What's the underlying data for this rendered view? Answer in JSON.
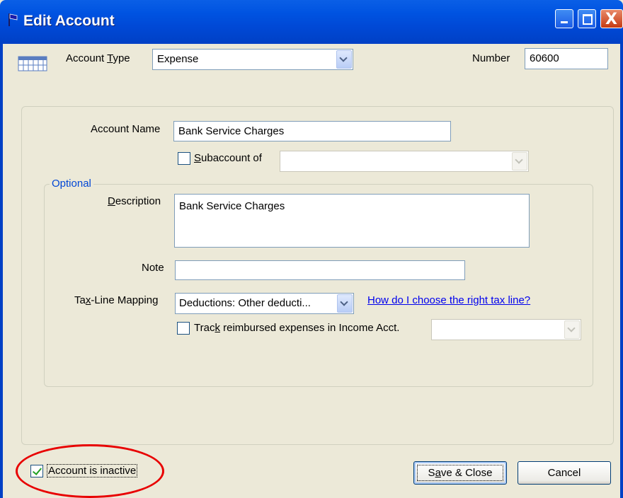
{
  "window": {
    "title": "Edit Account",
    "close_glyph": "X"
  },
  "header": {
    "account_type_label_pre": "Account ",
    "account_type_label_u": "T",
    "account_type_label_post": "ype",
    "account_type_value": "Expense",
    "number_label": "Number",
    "number_value": "60600"
  },
  "form": {
    "account_name_label": "Account Name",
    "account_name_value": "Bank Service Charges",
    "subaccount_label_u": "S",
    "subaccount_label_post": "ubaccount of",
    "subaccount_value": "",
    "subaccount_checked": false
  },
  "optional": {
    "legend": "Optional",
    "description_label_u": "D",
    "description_label_post": "escription",
    "description_value": "Bank Service Charges",
    "note_label": "Note",
    "note_value": "",
    "tax_label_pre": "Ta",
    "tax_label_u": "x",
    "tax_label_post": "-Line Mapping",
    "tax_value": "Deductions: Other deducti...",
    "tax_help_link": "How do I choose the right tax line?",
    "track_label_pre": "Trac",
    "track_label_u": "k",
    "track_label_post": " reimbursed expenses in Income Acct.",
    "track_checked": false,
    "track_account_value": ""
  },
  "footer": {
    "inactive_label": "Account is inactive",
    "inactive_checked": true,
    "save_pre": "S",
    "save_u": "a",
    "save_post": "ve & Close",
    "cancel_label": "Cancel"
  },
  "colors": {
    "titlebar": "#0053e1",
    "dialog_bg": "#ece9d8",
    "group_legend": "#0046d5",
    "link": "#0000ee",
    "annotation_ring": "#e80000",
    "check_mark": "#21a121"
  },
  "icons": [
    "quickbooks-window-icon",
    "account-register-icon",
    "minimize-icon",
    "maximize-icon",
    "close-icon",
    "chevron-down-icon",
    "checkmark-icon"
  ]
}
